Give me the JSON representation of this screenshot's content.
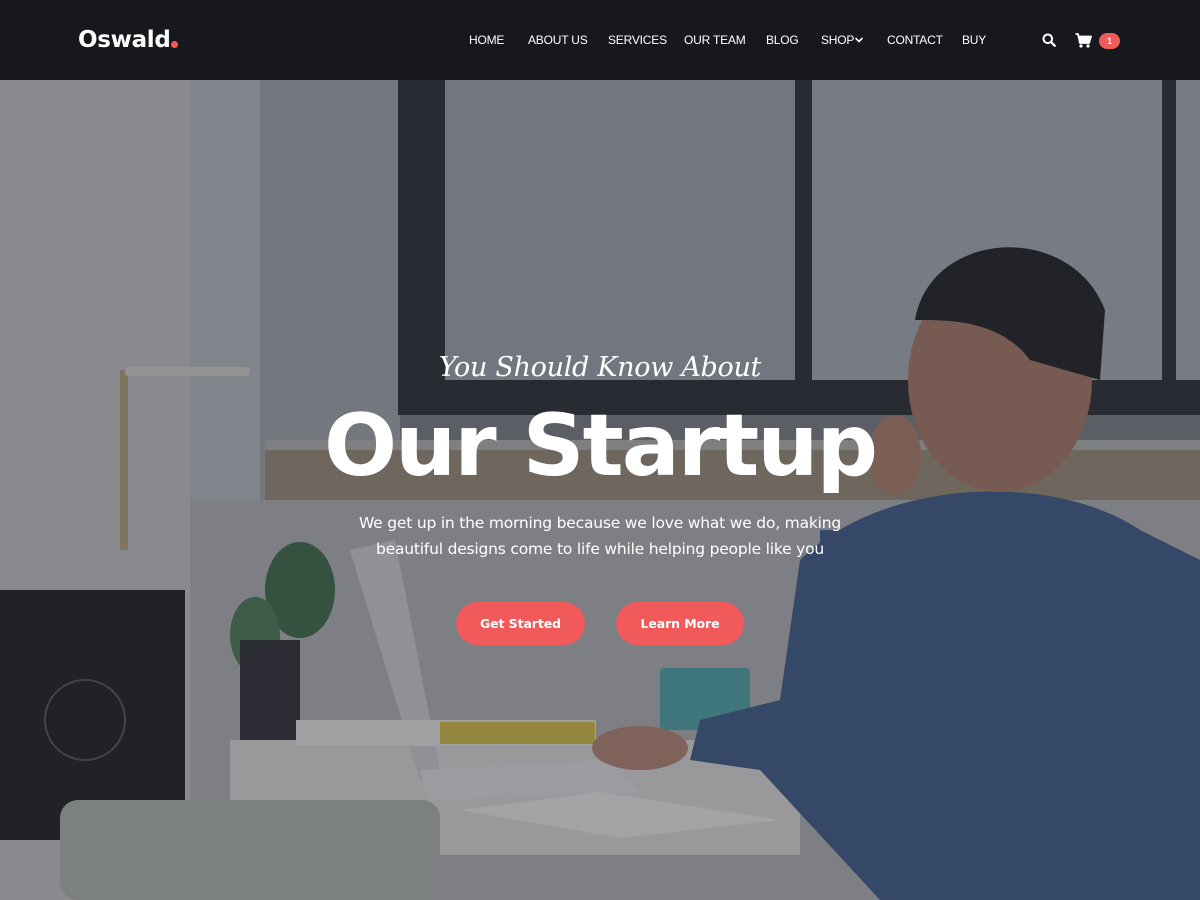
{
  "site": {
    "logo": "Oswald",
    "accent_color": "#f05a5b"
  },
  "nav": {
    "items": [
      {
        "label": "HOME"
      },
      {
        "label": "ABOUT US"
      },
      {
        "label": "SERVICES"
      },
      {
        "label": "OUR TEAM"
      },
      {
        "label": "BLOG"
      },
      {
        "label": "SHOP",
        "has_dropdown": true
      },
      {
        "label": "CONTACT"
      },
      {
        "label": "BUY"
      }
    ],
    "search_icon": "search-icon",
    "cart_icon": "cart-icon",
    "cart_count": "1"
  },
  "hero": {
    "subtitle": "You Should Know About",
    "title": "Our Startup",
    "description_line1": "We get up in the morning because we love what we do, making",
    "description_line2": "beautiful designs come to life while helping people like you",
    "primary_button": "Get Started",
    "secondary_button": "Learn More",
    "background_image": "man working on laptop at desk by window"
  }
}
